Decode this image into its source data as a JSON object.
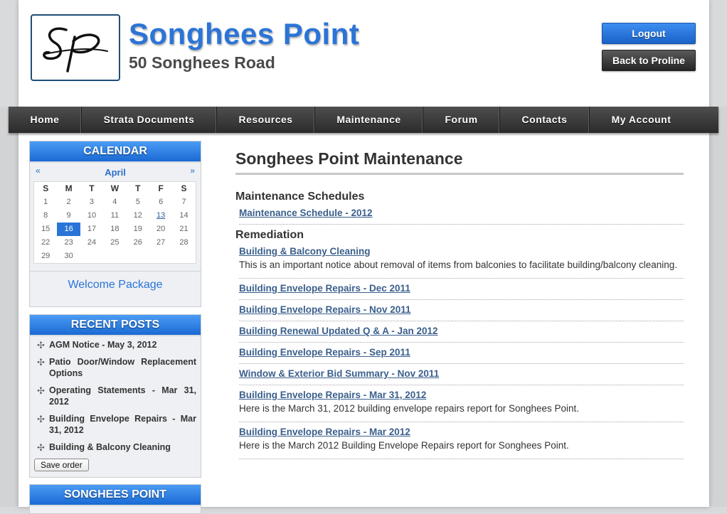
{
  "header": {
    "site_title": "Songhees Point",
    "site_subtitle": "50 Songhees Road",
    "logo_text": "SP",
    "logout_label": "Logout",
    "back_label": "Back to Proline"
  },
  "nav": {
    "items": [
      {
        "label": "Home"
      },
      {
        "label": "Strata Documents"
      },
      {
        "label": "Resources"
      },
      {
        "label": "Maintenance"
      },
      {
        "label": "Forum"
      },
      {
        "label": "Contacts"
      },
      {
        "label": "My Account"
      }
    ]
  },
  "calendar": {
    "title": "CALENDAR",
    "month": "April",
    "prev": "«",
    "next": "»",
    "weekdays": [
      "S",
      "M",
      "T",
      "W",
      "T",
      "F",
      "S"
    ],
    "weeks": [
      [
        "1",
        "2",
        "3",
        "4",
        "5",
        "6",
        "7"
      ],
      [
        "8",
        "9",
        "10",
        "11",
        "12",
        "13",
        "14"
      ],
      [
        "15",
        "16",
        "17",
        "18",
        "19",
        "20",
        "21"
      ],
      [
        "22",
        "23",
        "24",
        "25",
        "26",
        "27",
        "28"
      ],
      [
        "29",
        "30",
        "",
        "",
        "",
        "",
        ""
      ]
    ],
    "today": "16",
    "linked_day": "13",
    "welcome_package": "Welcome Package"
  },
  "recent_posts": {
    "title": "RECENT POSTS",
    "items": [
      {
        "label": "AGM Notice - May 3, 2012"
      },
      {
        "label": "Patio Door/Window Replacement Options"
      },
      {
        "label": "Operating Statements - Mar 31, 2012"
      },
      {
        "label": "Building Envelope Repairs - Mar 31, 2012"
      },
      {
        "label": "Building & Balcony Cleaning"
      }
    ],
    "save_order": "Save order"
  },
  "songhees_widget": {
    "title": "SONGHEES POINT"
  },
  "main": {
    "title": "Songhees Point Maintenance",
    "sections": [
      {
        "heading": "Maintenance Schedules",
        "entries": [
          {
            "title": "Maintenance Schedule - 2012",
            "desc": ""
          }
        ]
      },
      {
        "heading": "Remediation",
        "entries": [
          {
            "title": "Building & Balcony Cleaning",
            "desc": "This is an important notice about removal of items from balconies to facilitate building/balcony cleaning."
          },
          {
            "title": "Building Envelope Repairs - Dec 2011",
            "desc": ""
          },
          {
            "title": "Building Envelope Repairs - Nov 2011",
            "desc": ""
          },
          {
            "title": "Building Renewal Updated Q & A - Jan 2012",
            "desc": ""
          },
          {
            "title": "Building Envelope Repairs - Sep 2011",
            "desc": ""
          },
          {
            "title": "Window & Exterior Bid Summary - Nov 2011",
            "desc": ""
          },
          {
            "title": "Building Envelope Repairs - Mar 31, 2012",
            "desc": "Here is the March 31, 2012  building envelope repairs report for Songhees Point."
          },
          {
            "title": "Building Envelope Repairs - Mar 2012",
            "desc": "Here is the March 2012 Building Envelope Repairs report for Songhees Point."
          }
        ]
      }
    ]
  }
}
